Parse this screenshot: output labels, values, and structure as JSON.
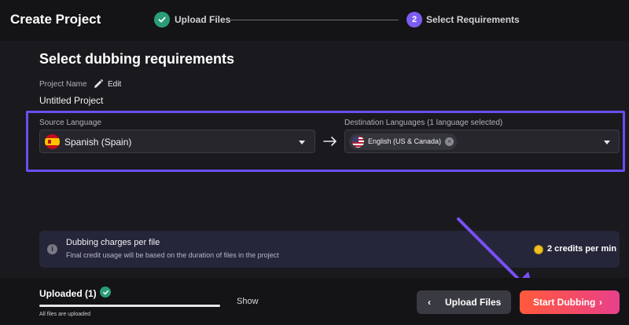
{
  "header": {
    "title": "Create Project",
    "steps": [
      {
        "label": "Upload Files",
        "status": "done"
      },
      {
        "number": "2",
        "label": "Select Requirements",
        "status": "current"
      }
    ]
  },
  "main": {
    "section_title": "Select dubbing requirements",
    "project_name_label": "Project Name",
    "edit_label": "Edit",
    "project_name": "Untitled Project",
    "source_language": {
      "label": "Source Language",
      "value": "Spanish (Spain)",
      "flag": "spain-flag-icon"
    },
    "destination_languages": {
      "label": "Destination Languages (1 language selected)",
      "selected": [
        "English (US & Canada)"
      ],
      "flag": "usa-flag-icon"
    },
    "info": {
      "title": "Dubbing charges per file",
      "subtitle": "Final credit usage will be based on the duration of files in the project",
      "credits": "2 credits per min"
    }
  },
  "footer": {
    "uploaded_label": "Uploaded (1)",
    "progress": 1.0,
    "status_text": "All files are uploaded",
    "show_label": "Show",
    "upload_files_button": "Upload Files",
    "start_dubbing_button": "Start Dubbing"
  },
  "colors": {
    "accent": "#7c5cf0",
    "highlight_border": "#6b4ef0",
    "success": "#2a9d78",
    "start_button_gradient": [
      "#ff5a3c",
      "#e8408a"
    ]
  }
}
